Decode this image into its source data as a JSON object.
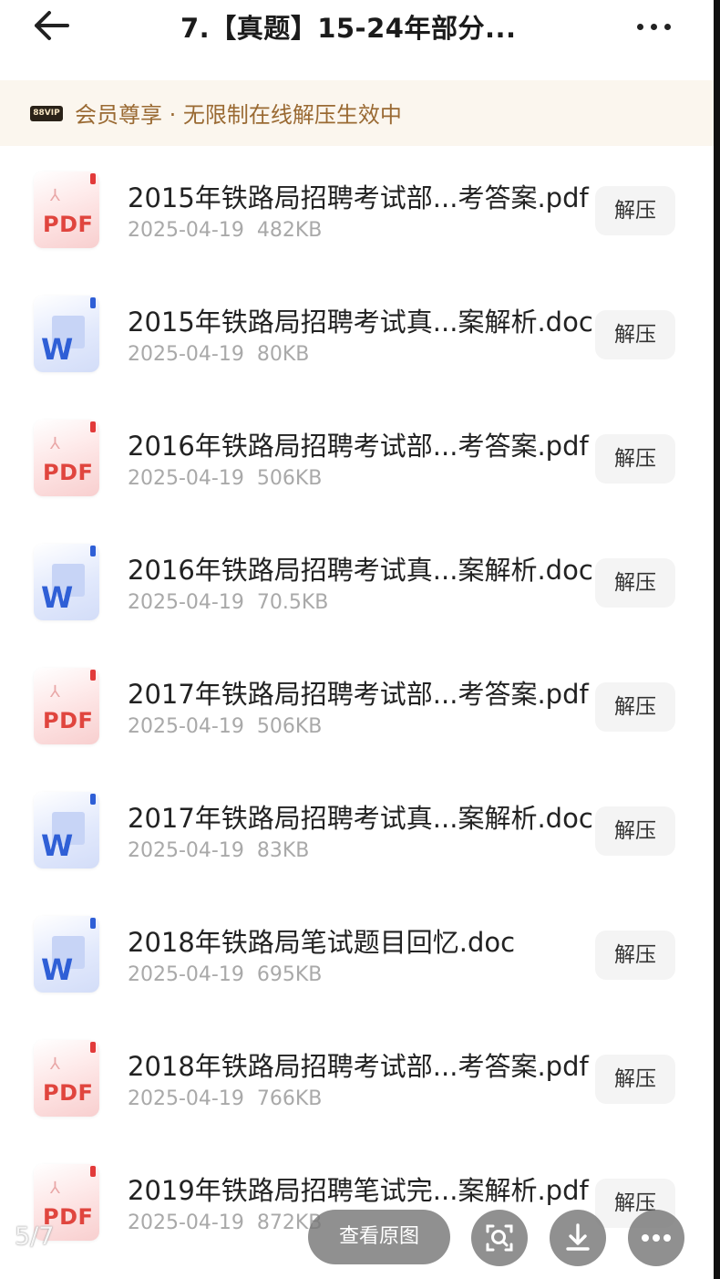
{
  "header": {
    "title": "7.【真题】15-24年部分...",
    "back_icon": "arrow-left-icon",
    "more_icon": "more-horizontal-icon"
  },
  "banner": {
    "badge": "88VIP",
    "text": "会员尊享 · 无限制在线解压生效中"
  },
  "files": [
    {
      "type": "pdf",
      "icon_label": "PDF",
      "name": "2015年铁路局招聘考试部...考答案.pdf",
      "date": "2025-04-19",
      "size": "482KB",
      "action": "解压"
    },
    {
      "type": "doc",
      "icon_label": "W",
      "name": "2015年铁路局招聘考试真...案解析.doc",
      "date": "2025-04-19",
      "size": "80KB",
      "action": "解压"
    },
    {
      "type": "pdf",
      "icon_label": "PDF",
      "name": "2016年铁路局招聘考试部...考答案.pdf",
      "date": "2025-04-19",
      "size": "506KB",
      "action": "解压"
    },
    {
      "type": "doc",
      "icon_label": "W",
      "name": "2016年铁路局招聘考试真...案解析.doc",
      "date": "2025-04-19",
      "size": "70.5KB",
      "action": "解压"
    },
    {
      "type": "pdf",
      "icon_label": "PDF",
      "name": "2017年铁路局招聘考试部...考答案.pdf",
      "date": "2025-04-19",
      "size": "506KB",
      "action": "解压"
    },
    {
      "type": "doc",
      "icon_label": "W",
      "name": "2017年铁路局招聘考试真...案解析.doc",
      "date": "2025-04-19",
      "size": "83KB",
      "action": "解压"
    },
    {
      "type": "doc",
      "icon_label": "W",
      "name": "2018年铁路局笔试题目回忆.doc",
      "date": "2025-04-19",
      "size": "695KB",
      "action": "解压"
    },
    {
      "type": "pdf",
      "icon_label": "PDF",
      "name": "2018年铁路局招聘考试部...考答案.pdf",
      "date": "2025-04-19",
      "size": "766KB",
      "action": "解压"
    },
    {
      "type": "pdf",
      "icon_label": "PDF",
      "name": "2019年铁路局招聘笔试完...案解析.pdf",
      "date": "2025-04-19",
      "size": "872KB",
      "action": "解压"
    }
  ],
  "viewer": {
    "pager": "5/7",
    "view_original": "查看原图",
    "buttons": [
      "image-search-icon",
      "download-icon",
      "more-horizontal-icon"
    ]
  }
}
